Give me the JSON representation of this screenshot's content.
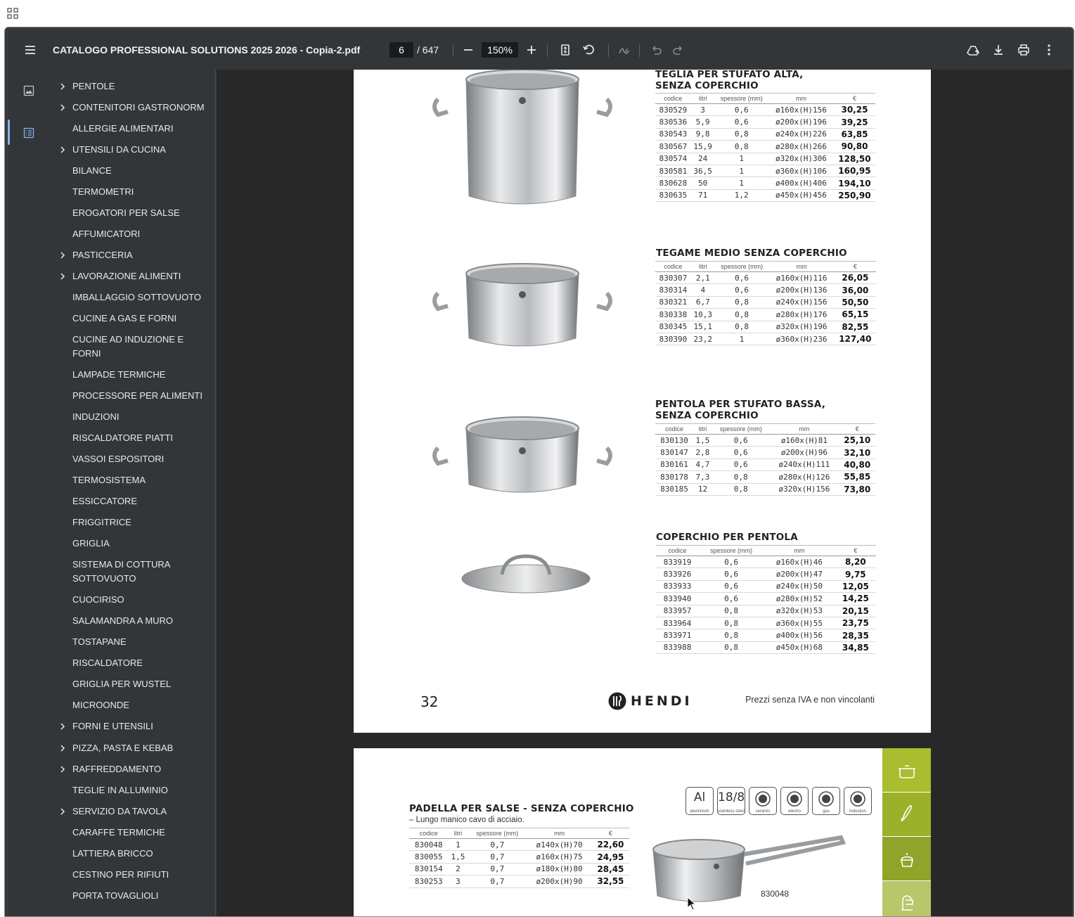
{
  "browser": {
    "apps_icon": "apps-grid-icon"
  },
  "toolbar": {
    "title": "CATALOGO PROFESSIONAL SOLUTIONS 2025 2026 - Copia-2.pdf",
    "page_current": "6",
    "page_total": "/ 647",
    "zoom": "150%"
  },
  "sidebar": {
    "items": [
      {
        "label": "PENTOLE",
        "expandable": true
      },
      {
        "label": "CONTENITORI GASTRONORM",
        "expandable": true
      },
      {
        "label": "ALLERGIE ALIMENTARI",
        "expandable": false
      },
      {
        "label": "UTENSILI DA CUCINA",
        "expandable": true
      },
      {
        "label": "BILANCE",
        "expandable": false
      },
      {
        "label": "TERMOMETRI",
        "expandable": false
      },
      {
        "label": "EROGATORI PER SALSE",
        "expandable": false
      },
      {
        "label": "AFFUMICATORI",
        "expandable": false
      },
      {
        "label": "PASTICCERIA",
        "expandable": true
      },
      {
        "label": "LAVORAZIONE ALIMENTI",
        "expandable": true
      },
      {
        "label": "IMBALLAGGIO SOTTOVUOTO",
        "expandable": false
      },
      {
        "label": "CUCINE A GAS E FORNI",
        "expandable": false
      },
      {
        "label": "CUCINE AD INDUZIONE E FORNI",
        "expandable": false
      },
      {
        "label": "LAMPADE TERMICHE",
        "expandable": false
      },
      {
        "label": "PROCESSORE PER ALIMENTI",
        "expandable": false
      },
      {
        "label": "INDUZIONI",
        "expandable": false
      },
      {
        "label": "RISCALDATORE PIATTI",
        "expandable": false
      },
      {
        "label": "VASSOI ESPOSITORI",
        "expandable": false
      },
      {
        "label": "TERMOSISTEMA",
        "expandable": false
      },
      {
        "label": "ESSICCATORE",
        "expandable": false
      },
      {
        "label": "FRIGGITRICE",
        "expandable": false
      },
      {
        "label": "GRIGLIA",
        "expandable": false
      },
      {
        "label": "SISTEMA DI COTTURA SOTTOVUOTO",
        "expandable": false
      },
      {
        "label": "CUOCIRISO",
        "expandable": false
      },
      {
        "label": "SALAMANDRA A MURO",
        "expandable": false
      },
      {
        "label": "TOSTAPANE",
        "expandable": false
      },
      {
        "label": "RISCALDATORE",
        "expandable": false
      },
      {
        "label": "GRIGLIA PER WUSTEL",
        "expandable": false
      },
      {
        "label": "MICROONDE",
        "expandable": false
      },
      {
        "label": "FORNI E UTENSILI",
        "expandable": true
      },
      {
        "label": "PIZZA, PASTA E KEBAB",
        "expandable": true
      },
      {
        "label": "RAFFREDDAMENTO",
        "expandable": true
      },
      {
        "label": "TEGLIE IN ALLUMINIO",
        "expandable": false
      },
      {
        "label": "SERVIZIO DA TAVOLA",
        "expandable": true
      },
      {
        "label": "CARAFFE TERMICHE",
        "expandable": false
      },
      {
        "label": "LATTIERA BRICCO",
        "expandable": false
      },
      {
        "label": "CESTINO PER RIFIUTI",
        "expandable": false
      },
      {
        "label": "PORTA TOVAGLIOLI",
        "expandable": false
      }
    ]
  },
  "page1": {
    "sections": [
      {
        "title": "TEGLIA PER STUFATO ALTA,\nSENZA COPERCHIO",
        "headers": [
          "codice",
          "litri",
          "spessore (mm)",
          "mm",
          "€"
        ],
        "rows": [
          [
            "830529",
            "3",
            "0,6",
            "ø160x(H)156",
            "30,25"
          ],
          [
            "830536",
            "5,9",
            "0,6",
            "ø200x(H)196",
            "39,25"
          ],
          [
            "830543",
            "9,8",
            "0,8",
            "ø240x(H)226",
            "63,85"
          ],
          [
            "830567",
            "15,9",
            "0,8",
            "ø280x(H)266",
            "90,80"
          ],
          [
            "830574",
            "24",
            "1",
            "ø320x(H)306",
            "128,50"
          ],
          [
            "830581",
            "36,5",
            "1",
            "ø360x(H)106",
            "160,95"
          ],
          [
            "830628",
            "50",
            "1",
            "ø400x(H)406",
            "194,10"
          ],
          [
            "830635",
            "71",
            "1,2",
            "ø450x(H)456",
            "250,90"
          ]
        ]
      },
      {
        "title": "TEGAME MEDIO SENZA COPERCHIO",
        "headers": [
          "codice",
          "litri",
          "spessore (mm)",
          "mm",
          "€"
        ],
        "rows": [
          [
            "830307",
            "2,1",
            "0,6",
            "ø160x(H)116",
            "26,05"
          ],
          [
            "830314",
            "4",
            "0,6",
            "ø200x(H)136",
            "36,00"
          ],
          [
            "830321",
            "6,7",
            "0,8",
            "ø240x(H)156",
            "50,50"
          ],
          [
            "830338",
            "10,3",
            "0,8",
            "ø280x(H)176",
            "65,15"
          ],
          [
            "830345",
            "15,1",
            "0,8",
            "ø320x(H)196",
            "82,55"
          ],
          [
            "830390",
            "23,2",
            "1",
            "ø360x(H)236",
            "127,40"
          ]
        ]
      },
      {
        "title": "PENTOLA PER STUFATO BASSA,\nSENZA COPERCHIO",
        "headers": [
          "codice",
          "litri",
          "spessore (mm)",
          "mm",
          "€"
        ],
        "rows": [
          [
            "830130",
            "1,5",
            "0,6",
            "ø160x(H)81",
            "25,10"
          ],
          [
            "830147",
            "2,8",
            "0,6",
            "ø200x(H)96",
            "32,10"
          ],
          [
            "830161",
            "4,7",
            "0,6",
            "ø240x(H)111",
            "40,80"
          ],
          [
            "830178",
            "7,3",
            "0,8",
            "ø280x(H)126",
            "55,85"
          ],
          [
            "830185",
            "12",
            "0,8",
            "ø320x(H)156",
            "73,80"
          ]
        ]
      },
      {
        "title": "COPERCHIO PER PENTOLA",
        "headers": [
          "codice",
          "spessore (mm)",
          "mm",
          "€"
        ],
        "rows": [
          [
            "833919",
            "0,6",
            "ø160x(H)46",
            "8,20"
          ],
          [
            "833926",
            "0,6",
            "ø200x(H)47",
            "9,75"
          ],
          [
            "833933",
            "0,6",
            "ø240x(H)50",
            "12,05"
          ],
          [
            "833940",
            "0,6",
            "ø280x(H)52",
            "14,25"
          ],
          [
            "833957",
            "0,8",
            "ø320x(H)53",
            "20,15"
          ],
          [
            "833964",
            "0,8",
            "ø360x(H)55",
            "23,75"
          ],
          [
            "833971",
            "0,8",
            "ø400x(H)56",
            "28,35"
          ],
          [
            "833988",
            "0,8",
            "ø450x(H)68",
            "34,85"
          ]
        ]
      }
    ],
    "page_number": "32",
    "brand": "HENDI",
    "price_note": "Prezzi senza IVA e non vincolanti"
  },
  "page2": {
    "title": "PADELLA PER SALSE - SENZA COPERCHIO",
    "note": "–  Lungo manico cavo di acciaio.",
    "headers": [
      "codice",
      "litri",
      "spessore (mm)",
      "mm",
      "€"
    ],
    "rows": [
      [
        "830048",
        "1",
        "0,7",
        "ø140x(H)70",
        "22,60"
      ],
      [
        "830055",
        "1,5",
        "0,7",
        "ø160x(H)75",
        "24,95"
      ],
      [
        "830154",
        "2",
        "0,7",
        "ø180x(H)80",
        "28,45"
      ],
      [
        "830253",
        "3",
        "0,7",
        "ø200x(H)90",
        "32,55"
      ]
    ],
    "materials": [
      {
        "main": "Al",
        "label": "aluminium"
      },
      {
        "main": "18/8",
        "label": "stainless steel"
      },
      {
        "main": "",
        "label": "ceramic"
      },
      {
        "main": "",
        "label": "electro"
      },
      {
        "main": "",
        "label": "gas"
      },
      {
        "main": "",
        "label": "induction"
      }
    ],
    "product_code_label": "830048",
    "tab_colors": [
      "#a9bd2f",
      "#9cb12a",
      "#8fa428",
      "#b7c76a"
    ]
  }
}
